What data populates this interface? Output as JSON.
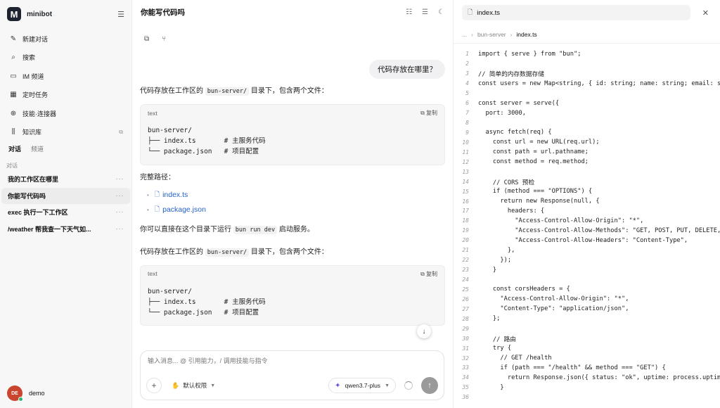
{
  "brand": {
    "logo_letter": "M",
    "name": "minibot"
  },
  "sidebar": {
    "nav": [
      {
        "icon": "edit-icon",
        "glyph": "✎",
        "label": "新建对话"
      },
      {
        "icon": "search-icon",
        "glyph": "⌕",
        "label": "搜索"
      },
      {
        "icon": "chat-icon",
        "glyph": "▭",
        "label": "IM 频道"
      },
      {
        "icon": "calendar-icon",
        "glyph": "▦",
        "label": "定时任务"
      },
      {
        "icon": "plug-icon",
        "glyph": "⊕",
        "label": "技能·连接器"
      },
      {
        "icon": "library-icon",
        "glyph": "⫼",
        "label": "知识库"
      }
    ],
    "tabs": [
      "对话",
      "频道"
    ],
    "section_label": "对话",
    "conversations": [
      {
        "title": "我的工作区在哪里",
        "active": false
      },
      {
        "title": "你能写代码吗",
        "active": true
      },
      {
        "title": "exec 执行一下工作区",
        "active": false
      },
      {
        "title": "/weather 帮我查一下天气如...",
        "active": false
      }
    ],
    "user": {
      "initials": "DE",
      "name": "demo",
      "status_color": "#2bb673"
    }
  },
  "chat": {
    "title": "你能写代码吗",
    "user_message": "代码存放在哪里？",
    "answer1": {
      "p1_before": "代码存放在工作区的 ",
      "p1_code": "bun-server/",
      "p1_after": " 目录下，包含两个文件：",
      "code_lang": "text",
      "copy_label": "复制",
      "code": "bun-server/\n├── index.ts       # 主服务代码\n└── package.json   # 项目配置",
      "path_heading": "完整路径：",
      "files": [
        "index.ts",
        "package.json"
      ],
      "run_before": "你可以直接在这个目录下运行 ",
      "run_code": "bun run dev",
      "run_after": " 启动服务。"
    },
    "answer2": {
      "p1_before": "代码存放在工作区的 ",
      "p1_code": "bun-server/",
      "p1_after": " 目录下，包含两个文件：",
      "code_lang": "text",
      "copy_label": "复制",
      "code": "bun-server/\n├── index.ts       # 主服务代码\n└── package.json   # 项目配置"
    },
    "composer": {
      "placeholder": "输入消息... @ 引用能力，/ 调用技能与指令",
      "permission_label": "默认权限",
      "model": "qwen3.7-plus"
    }
  },
  "panel": {
    "file_name": "index.ts",
    "breadcrumb": [
      "...",
      "bun-server",
      "index.ts"
    ],
    "code_lines": [
      "import { serve } from \"bun\";",
      "",
      "// 简单的内存数据存储",
      "const users = new Map<string, { id: string; name: string; email: string }>();",
      "",
      "const server = serve({",
      "  port: 3000,",
      "",
      "  async fetch(req) {",
      "    const url = new URL(req.url);",
      "    const path = url.pathname;",
      "    const method = req.method;",
      "",
      "    // CORS 预检",
      "    if (method === \"OPTIONS\") {",
      "      return new Response(null, {",
      "        headers: {",
      "          \"Access-Control-Allow-Origin\": \"*\",",
      "          \"Access-Control-Allow-Methods\": \"GET, POST, PUT, DELETE, OPTIONS\",",
      "          \"Access-Control-Allow-Headers\": \"Content-Type\",",
      "        },",
      "      });",
      "    }",
      "",
      "    const corsHeaders = {",
      "      \"Access-Control-Allow-Origin\": \"*\",",
      "      \"Content-Type\": \"application/json\",",
      "    };",
      "",
      "    // 路由",
      "    try {",
      "      // GET /health",
      "      if (path === \"/health\" && method === \"GET\") {",
      "        return Response.json({ status: \"ok\", uptime: process.uptime() }, { headers: corsHeaders });",
      "      }",
      ""
    ]
  }
}
